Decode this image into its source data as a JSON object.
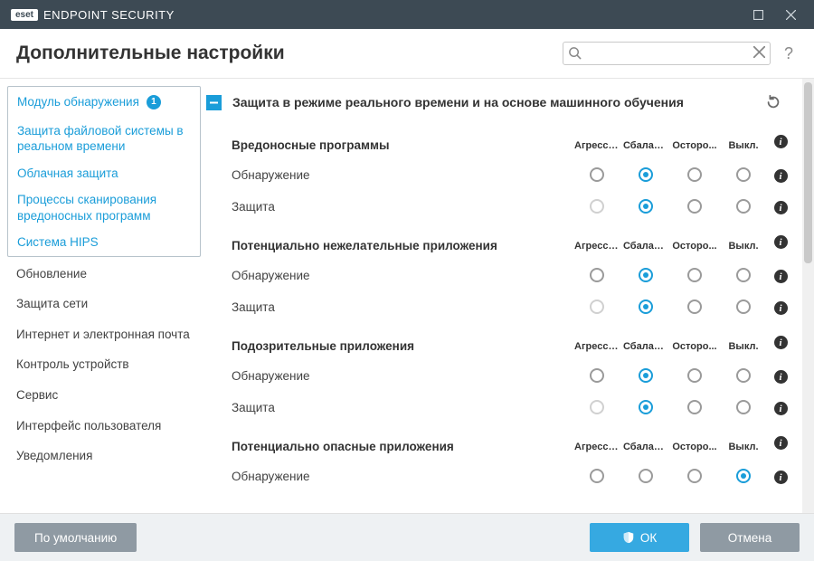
{
  "titlebar": {
    "brand_box": "eset",
    "brand_text": "ENDPOINT SECURITY"
  },
  "header": {
    "page_title": "Дополнительные настройки",
    "search_placeholder": "",
    "help": "?"
  },
  "sidebar": {
    "module": {
      "label": "Модуль обнаружения",
      "badge": "1",
      "children": [
        "Защита файловой системы в реальном времени",
        "Облачная защита",
        "Процессы сканирования вредоносных программ",
        "Система HIPS"
      ]
    },
    "items": [
      "Обновление",
      "Защита сети",
      "Интернет и электронная почта",
      "Контроль устройств",
      "Сервис",
      "Интерфейс пользователя",
      "Уведомления"
    ]
  },
  "section": {
    "title": "Защита в режиме реального времени и на основе машинного обучения"
  },
  "columns": [
    "Агресси...",
    "Сбаланс...",
    "Осторо...",
    "Выкл."
  ],
  "groups": [
    {
      "title": "Вредоносные программы",
      "rows": [
        {
          "label": "Обнаружение",
          "selected": 1,
          "disabled": []
        },
        {
          "label": "Защита",
          "selected": 1,
          "disabled": [
            0
          ]
        }
      ]
    },
    {
      "title": "Потенциально нежелательные приложения",
      "rows": [
        {
          "label": "Обнаружение",
          "selected": 1,
          "disabled": []
        },
        {
          "label": "Защита",
          "selected": 1,
          "disabled": [
            0
          ]
        }
      ]
    },
    {
      "title": "Подозрительные приложения",
      "rows": [
        {
          "label": "Обнаружение",
          "selected": 1,
          "disabled": []
        },
        {
          "label": "Защита",
          "selected": 1,
          "disabled": [
            0
          ]
        }
      ]
    },
    {
      "title": "Потенциально опасные приложения",
      "rows": [
        {
          "label": "Обнаружение",
          "selected": 3,
          "disabled": []
        }
      ]
    }
  ],
  "footer": {
    "default": "По умолчанию",
    "ok": "ОК",
    "cancel": "Отмена"
  }
}
